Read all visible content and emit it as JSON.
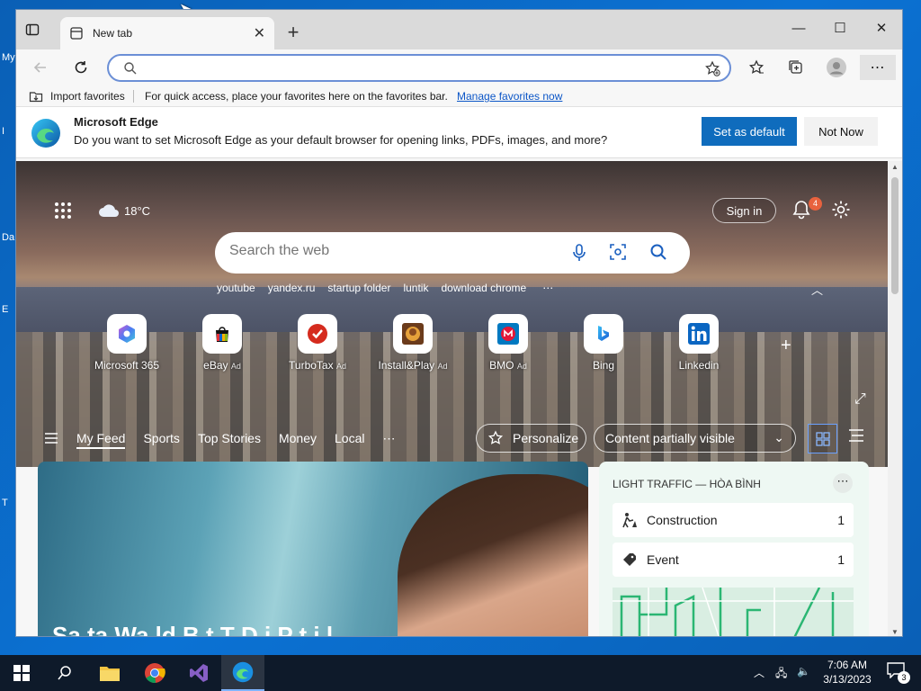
{
  "desktop": {
    "icon_fragments": [
      "My",
      "I",
      "Da",
      "E",
      "T"
    ]
  },
  "tab": {
    "title": "New tab"
  },
  "window_controls": {
    "minimize": "—",
    "maximize": "☐",
    "close": "✕"
  },
  "address_bar": {
    "placeholder": "",
    "value": ""
  },
  "favorites_bar": {
    "import_label": "Import favorites",
    "hint": "For quick access, place your favorites here on the favorites bar.",
    "manage_link": "Manage favorites now"
  },
  "infobar": {
    "title": "Microsoft Edge",
    "message": "Do you want to set Microsoft Edge as your default browser for opening links, PDFs, images, and more?",
    "primary": "Set as default",
    "secondary": "Not Now"
  },
  "ntp": {
    "weather": "18°C",
    "signin": "Sign in",
    "notifications": "4",
    "search_placeholder": "Search the web",
    "suggestions": [
      "youtube",
      "yandex.ru",
      "startup folder",
      "luntik",
      "download chrome"
    ],
    "suggestions_more": "⋯",
    "tiles": [
      {
        "label": "Microsoft 365",
        "ad": "",
        "icon": "m365-icon"
      },
      {
        "label": "eBay",
        "ad": "Ad",
        "icon": "ebay-icon"
      },
      {
        "label": "TurboTax",
        "ad": "Ad",
        "icon": "turbotax-icon"
      },
      {
        "label": "Install&Play",
        "ad": "Ad",
        "icon": "installplay-icon"
      },
      {
        "label": "BMO",
        "ad": "Ad",
        "icon": "bmo-icon"
      },
      {
        "label": "Bing",
        "ad": "",
        "icon": "bing-icon"
      },
      {
        "label": "Linkedin",
        "ad": "",
        "icon": "linkedin-icon"
      }
    ],
    "feed_tabs": [
      "My Feed",
      "Sports",
      "Top Stories",
      "Money",
      "Local"
    ],
    "feed_more": "⋯",
    "personalize": "Personalize",
    "content_visibility": "Content partially visible"
  },
  "main_card": {
    "headline": "Sa ta Wa ld B t T D i P t i l"
  },
  "traffic_card": {
    "header": "LIGHT TRAFFIC — HÒA BÌNH",
    "rows": [
      {
        "name": "Construction",
        "count": "1"
      },
      {
        "name": "Event",
        "count": "1"
      }
    ]
  },
  "taskbar": {
    "time": "7:06 AM",
    "date": "3/13/2023",
    "notification_count": "3"
  },
  "colors": {
    "accent": "#0f6cbd",
    "desktop": "#0b6fd0",
    "taskbar": "#0e1a2a",
    "badge": "#e8623e"
  }
}
